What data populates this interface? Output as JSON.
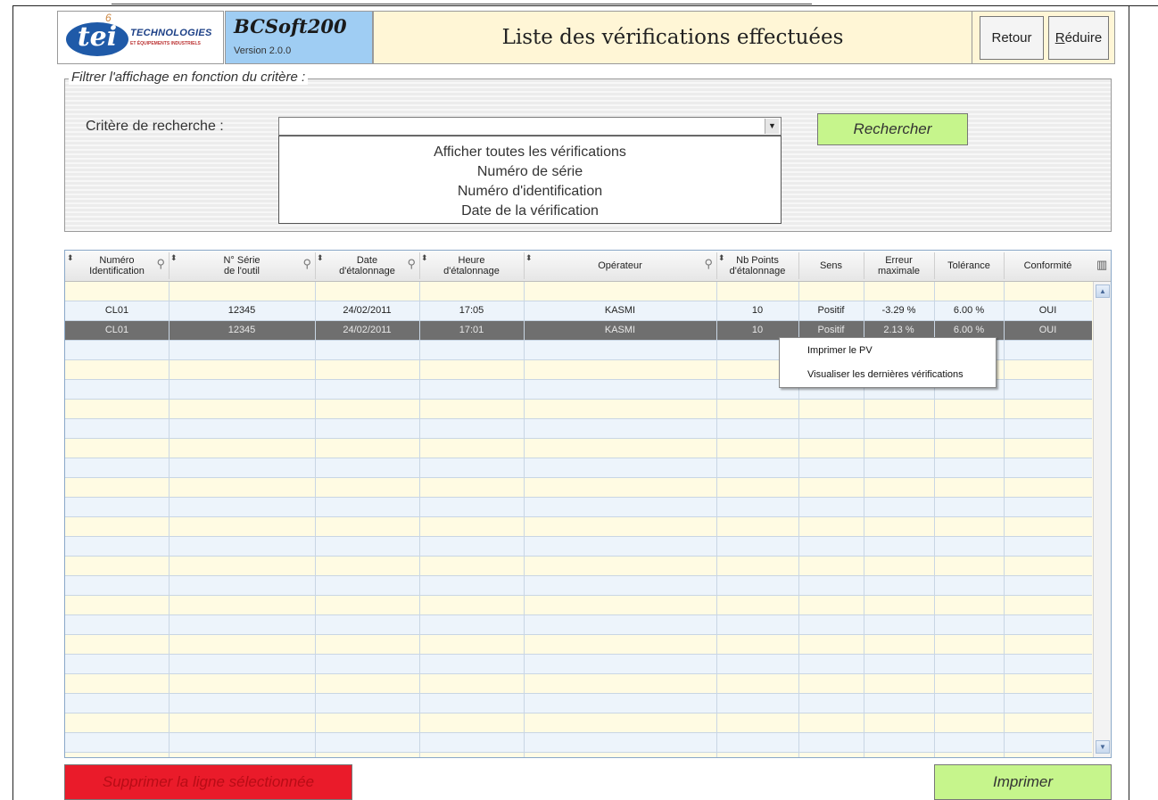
{
  "header": {
    "logo_brand": "tei",
    "logo_superscript": "6",
    "logo_company": "TECHNOLOGIES",
    "logo_tagline": "ET ÉQUIPEMENTS INDUSTRIELS",
    "app_name": "BCSoft200",
    "app_version": "Version 2.0.0",
    "title": "Liste des vérifications effectuées",
    "back_label": "Retour",
    "minimize_label_first": "R",
    "minimize_label_rest": "éduire"
  },
  "filter": {
    "legend": "Filtrer l'affichage en fonction du critère :",
    "criterion_label": "Critère de recherche :",
    "criterion_value": "",
    "criterion_options": [
      "Afficher toutes les vérifications",
      "Numéro de série",
      "Numéro d'identification",
      "Date de la vérification"
    ],
    "search_label": "Recherche",
    "search_label_suffix": "r"
  },
  "table": {
    "columns": [
      {
        "l1": "Numéro",
        "l2": "Identification"
      },
      {
        "l1": "N° Série",
        "l2": "de l'outil"
      },
      {
        "l1": "Date",
        "l2": "d'étalonnage"
      },
      {
        "l1": "Heure",
        "l2": "d'étalonnage"
      },
      {
        "l1": "Opérateur",
        "l2": ""
      },
      {
        "l1": "Nb Points",
        "l2": "d'étalonnage"
      },
      {
        "l1": "Sens",
        "l2": ""
      },
      {
        "l1": "Erreur",
        "l2": "maximale"
      },
      {
        "l1": "Tolérance",
        "l2": ""
      },
      {
        "l1": "Conformité",
        "l2": ""
      }
    ],
    "rows": [
      [
        "CL01",
        "12345",
        "24/02/2011",
        "17:05",
        "KASMI",
        "10",
        "Positif",
        "-3.29 %",
        "6.00 %",
        "OUI"
      ],
      [
        "CL01",
        "12345",
        "24/02/2011",
        "17:01",
        "KASMI",
        "10",
        "Positif",
        "2.13 %",
        "6.00 %",
        "OUI"
      ]
    ],
    "selected_row": 1
  },
  "context_menu": {
    "items": [
      "Imprimer le PV",
      "Visualiser les dernières vérifications"
    ]
  },
  "footer": {
    "delete_label": "Supprimer la ligne sélectionnée",
    "print_label": "Imprimer"
  },
  "icons": {
    "sort": "sort-arrows-icon",
    "search": "magnifier-icon",
    "column_chooser": "column-chooser-icon",
    "dropdown": "dropdown-arrow-icon",
    "scroll_up": "scroll-up-arrow-icon",
    "scroll_down": "scroll-down-arrow-icon"
  },
  "colors": {
    "app_box": "#9fcdf3",
    "title_bg": "#fff6d6",
    "green_button": "#c6f58c",
    "red_button": "#ea1b2a",
    "selected_row": "#6f6f6f"
  }
}
